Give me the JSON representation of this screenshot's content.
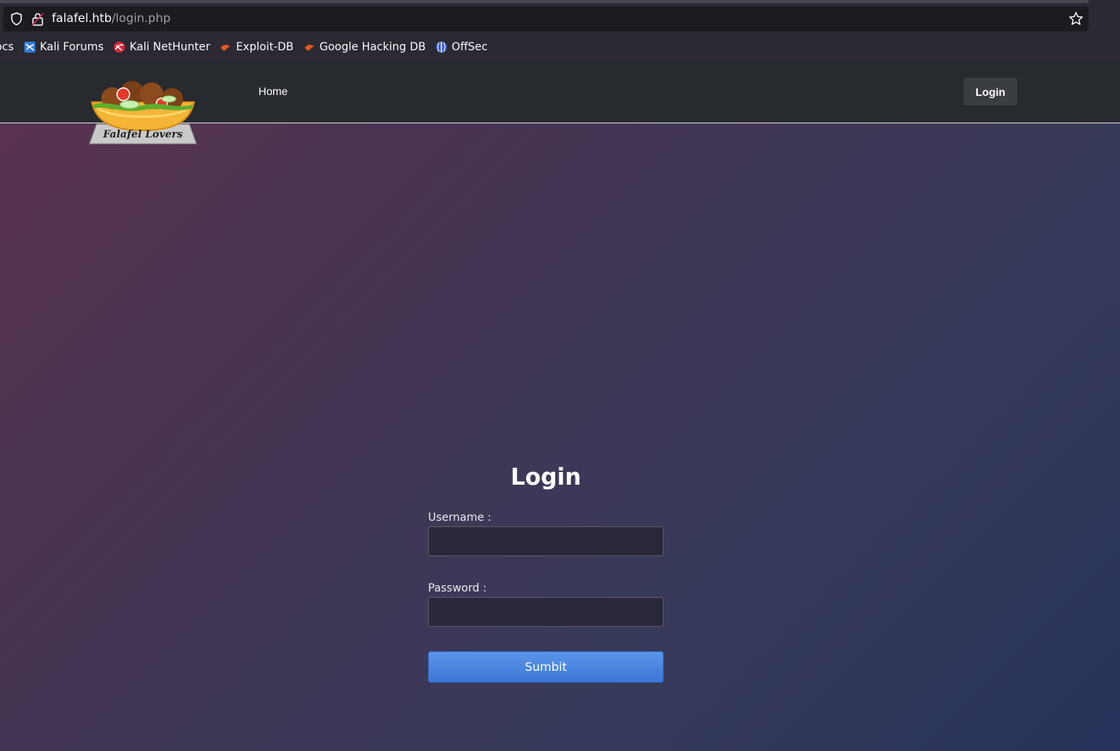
{
  "browser": {
    "url_host": "falafel.htb",
    "url_path": "/login.php",
    "bookmarks": [
      {
        "label": "ocs",
        "icon": "none"
      },
      {
        "label": "Kali Forums",
        "icon": "kali-forums-icon"
      },
      {
        "label": "Kali NetHunter",
        "icon": "kali-nethunter-icon"
      },
      {
        "label": "Exploit-DB",
        "icon": "exploit-db-icon"
      },
      {
        "label": "Google Hacking DB",
        "icon": "ghdb-icon"
      },
      {
        "label": "OffSec",
        "icon": "offsec-icon"
      }
    ]
  },
  "header": {
    "logo_text": "Falafel Lovers",
    "nav_home": "Home",
    "nav_login": "Login"
  },
  "login": {
    "title": "Login",
    "username_label": "Username :",
    "username_value": "",
    "password_label": "Password :",
    "password_value": "",
    "submit_label": "Sumbit"
  },
  "colors": {
    "header_bg": "#272a2f",
    "submit_blue": "#4a86e0",
    "gradient_start": "#5a3350",
    "gradient_end": "#26325a"
  }
}
